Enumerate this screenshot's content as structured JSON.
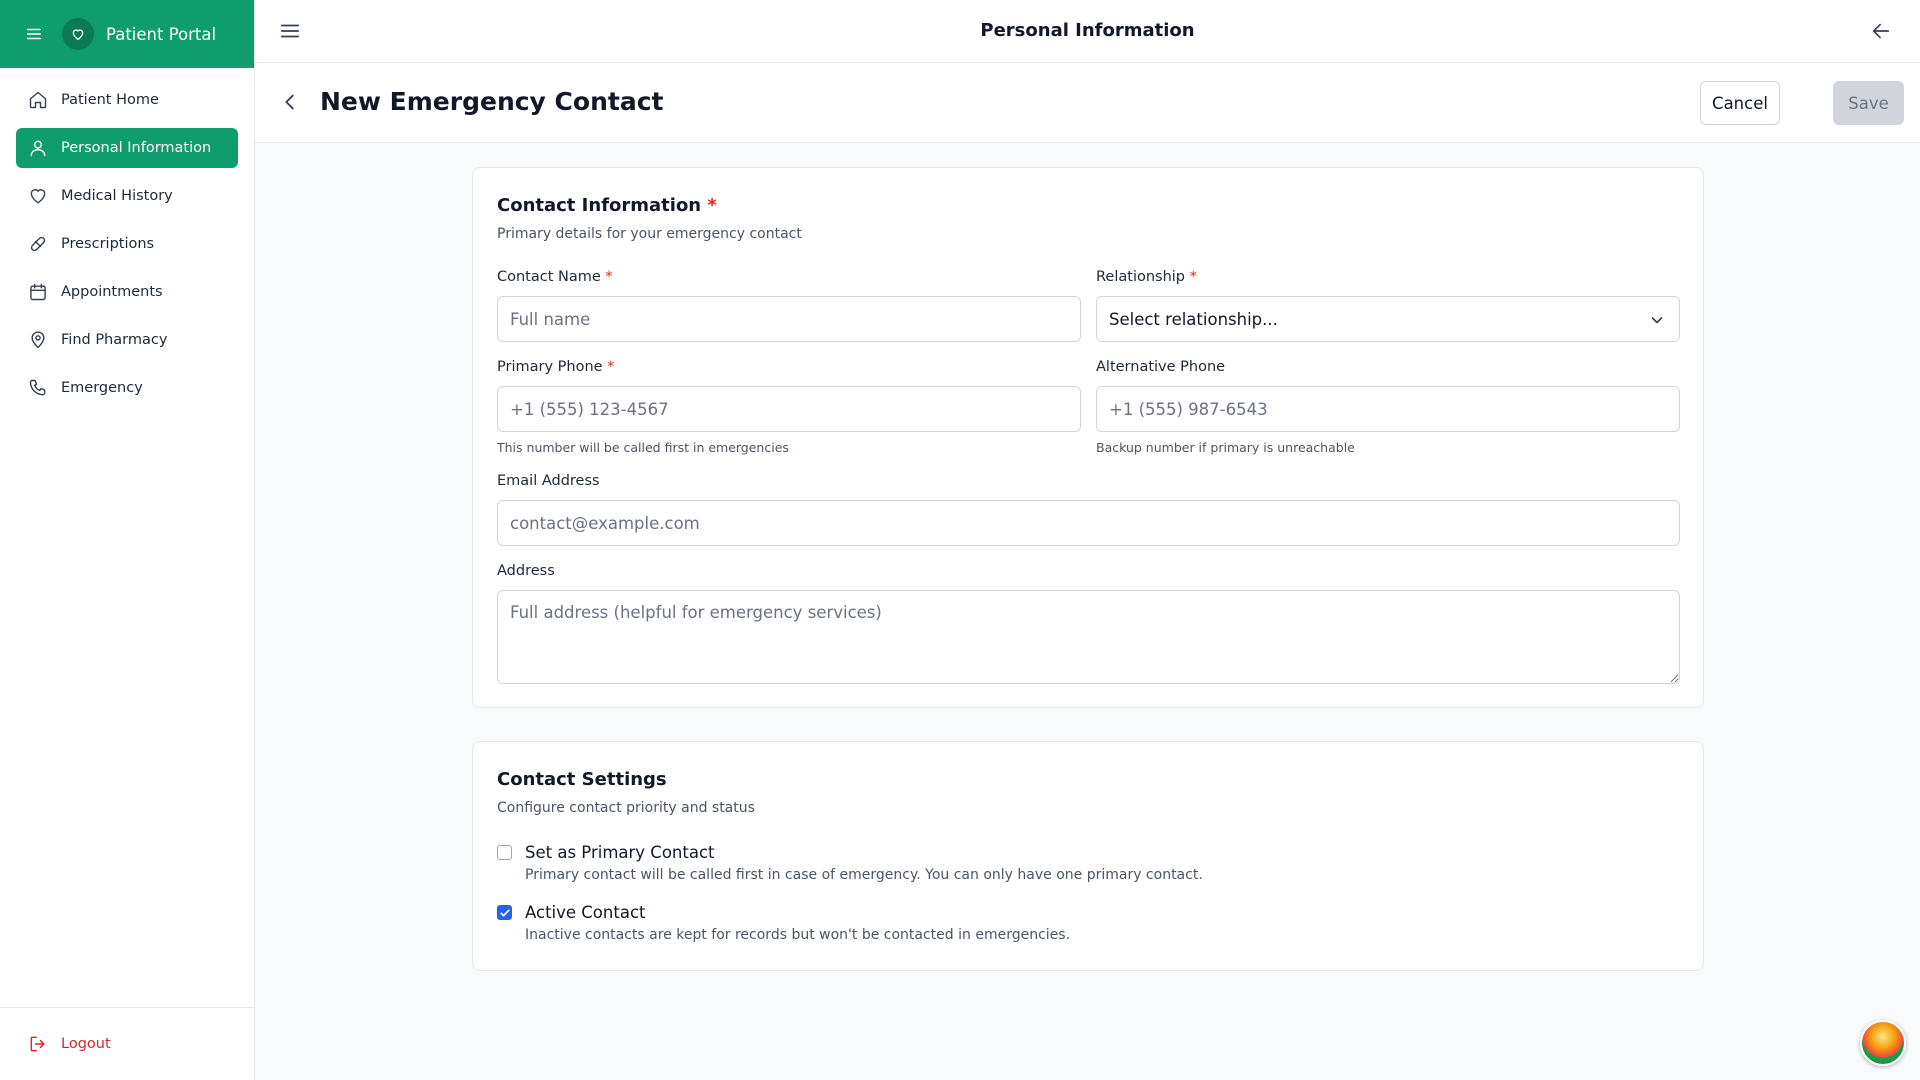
{
  "app": {
    "name": "Patient Portal"
  },
  "sidebar": {
    "items": [
      {
        "label": "Patient Home",
        "icon": "home-icon"
      },
      {
        "label": "Personal Information",
        "icon": "user-icon",
        "active": true
      },
      {
        "label": "Medical History",
        "icon": "heart-icon"
      },
      {
        "label": "Prescriptions",
        "icon": "pill-icon"
      },
      {
        "label": "Appointments",
        "icon": "calendar-icon"
      },
      {
        "label": "Find Pharmacy",
        "icon": "map-pin-icon"
      },
      {
        "label": "Emergency",
        "icon": "phone-icon"
      }
    ],
    "logout": "Logout"
  },
  "topbar": {
    "title": "Personal Information"
  },
  "page": {
    "title": "New Emergency Contact",
    "cancel": "Cancel",
    "save": "Save"
  },
  "contact_info": {
    "title": "Contact Information",
    "required_mark": "*",
    "subtitle": "Primary details for your emergency contact",
    "name_label": "Contact Name",
    "name_placeholder": "Full name",
    "relationship_label": "Relationship",
    "relationship_value": "Select relationship...",
    "primary_phone_label": "Primary Phone",
    "primary_phone_placeholder": "+1 (555) 123-4567",
    "primary_phone_help": "This number will be called first in emergencies",
    "alt_phone_label": "Alternative Phone",
    "alt_phone_placeholder": "+1 (555) 987-6543",
    "alt_phone_help": "Backup number if primary is unreachable",
    "email_label": "Email Address",
    "email_placeholder": "contact@example.com",
    "address_label": "Address",
    "address_placeholder": "Full address (helpful for emergency services)"
  },
  "settings": {
    "title": "Contact Settings",
    "subtitle": "Configure contact priority and status",
    "primary_title": "Set as Primary Contact",
    "primary_desc": "Primary contact will be called first in case of emergency. You can only have one primary contact.",
    "primary_checked": false,
    "active_title": "Active Contact",
    "active_desc": "Inactive contacts are kept for records but won't be contacted in emergencies.",
    "active_checked": true
  },
  "colors": {
    "brand": "#0f9d6e",
    "danger": "#dc2626",
    "checkbox": "#2563eb"
  }
}
